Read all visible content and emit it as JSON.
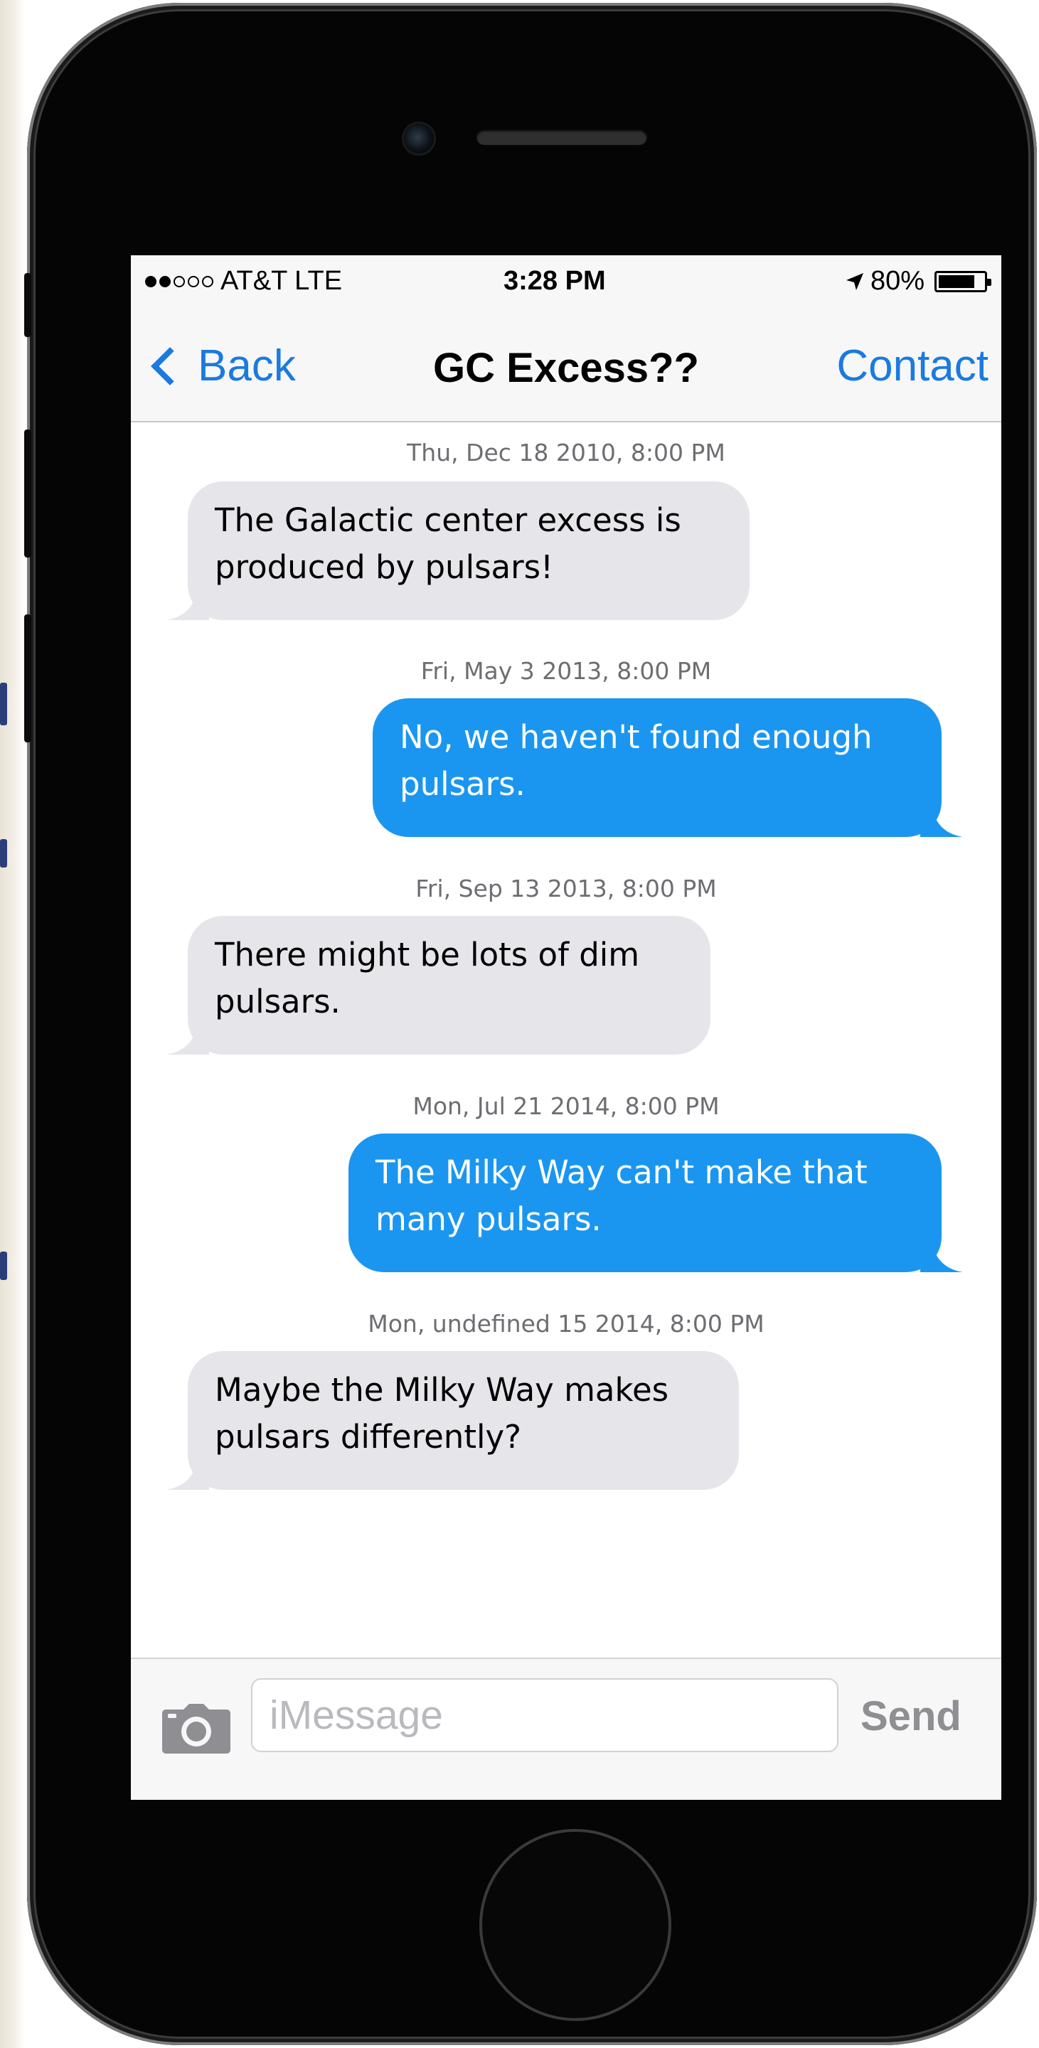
{
  "status_bar": {
    "carrier": "AT&T LTE",
    "time": "3:28 PM",
    "battery_text": "80%",
    "battery_level": 0.8,
    "signal_bars_filled": 2,
    "signal_bars_total": 5
  },
  "nav": {
    "back_label": "Back",
    "title": "GC Excess??",
    "contact_label": "Contact"
  },
  "messages": [
    {
      "timestamp": "Thu, Dec 18 2010, 8:00 PM",
      "direction": "incoming",
      "lines": [
        "The Galactic center excess is",
        "produced by pulsars!"
      ]
    },
    {
      "timestamp": "Fri, May 3 2013, 8:00 PM",
      "direction": "outgoing",
      "lines": [
        "No, we haven't found enough",
        "pulsars."
      ]
    },
    {
      "timestamp": "Fri, Sep 13 2013, 8:00 PM",
      "direction": "incoming",
      "lines": [
        "There might be lots of dim",
        "pulsars."
      ]
    },
    {
      "timestamp": "Mon, Jul 21 2014, 8:00 PM",
      "direction": "outgoing",
      "lines": [
        "The Milky Way can't make that",
        "many pulsars."
      ]
    },
    {
      "timestamp": "Mon, undefined 15 2014, 8:00 PM",
      "direction": "incoming",
      "lines": [
        "Maybe the Milky Way makes",
        "pulsars differently?"
      ]
    }
  ],
  "input_bar": {
    "placeholder": "iMessage",
    "send_label": "Send",
    "camera_icon": "camera-icon"
  },
  "colors": {
    "accent": "#1a7ae0",
    "outgoing_bubble": "#1a96f0",
    "incoming_bubble": "#e5e5ea",
    "phone_body": "#050505"
  }
}
